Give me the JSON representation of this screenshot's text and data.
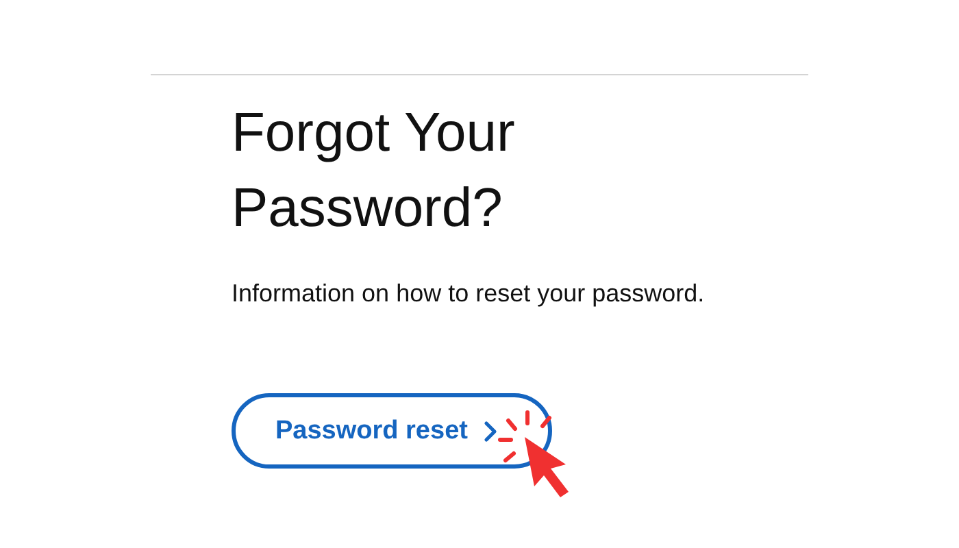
{
  "heading": "Forgot Your Password?",
  "description": "Information on how to reset your password.",
  "button": {
    "label": "Password reset"
  }
}
